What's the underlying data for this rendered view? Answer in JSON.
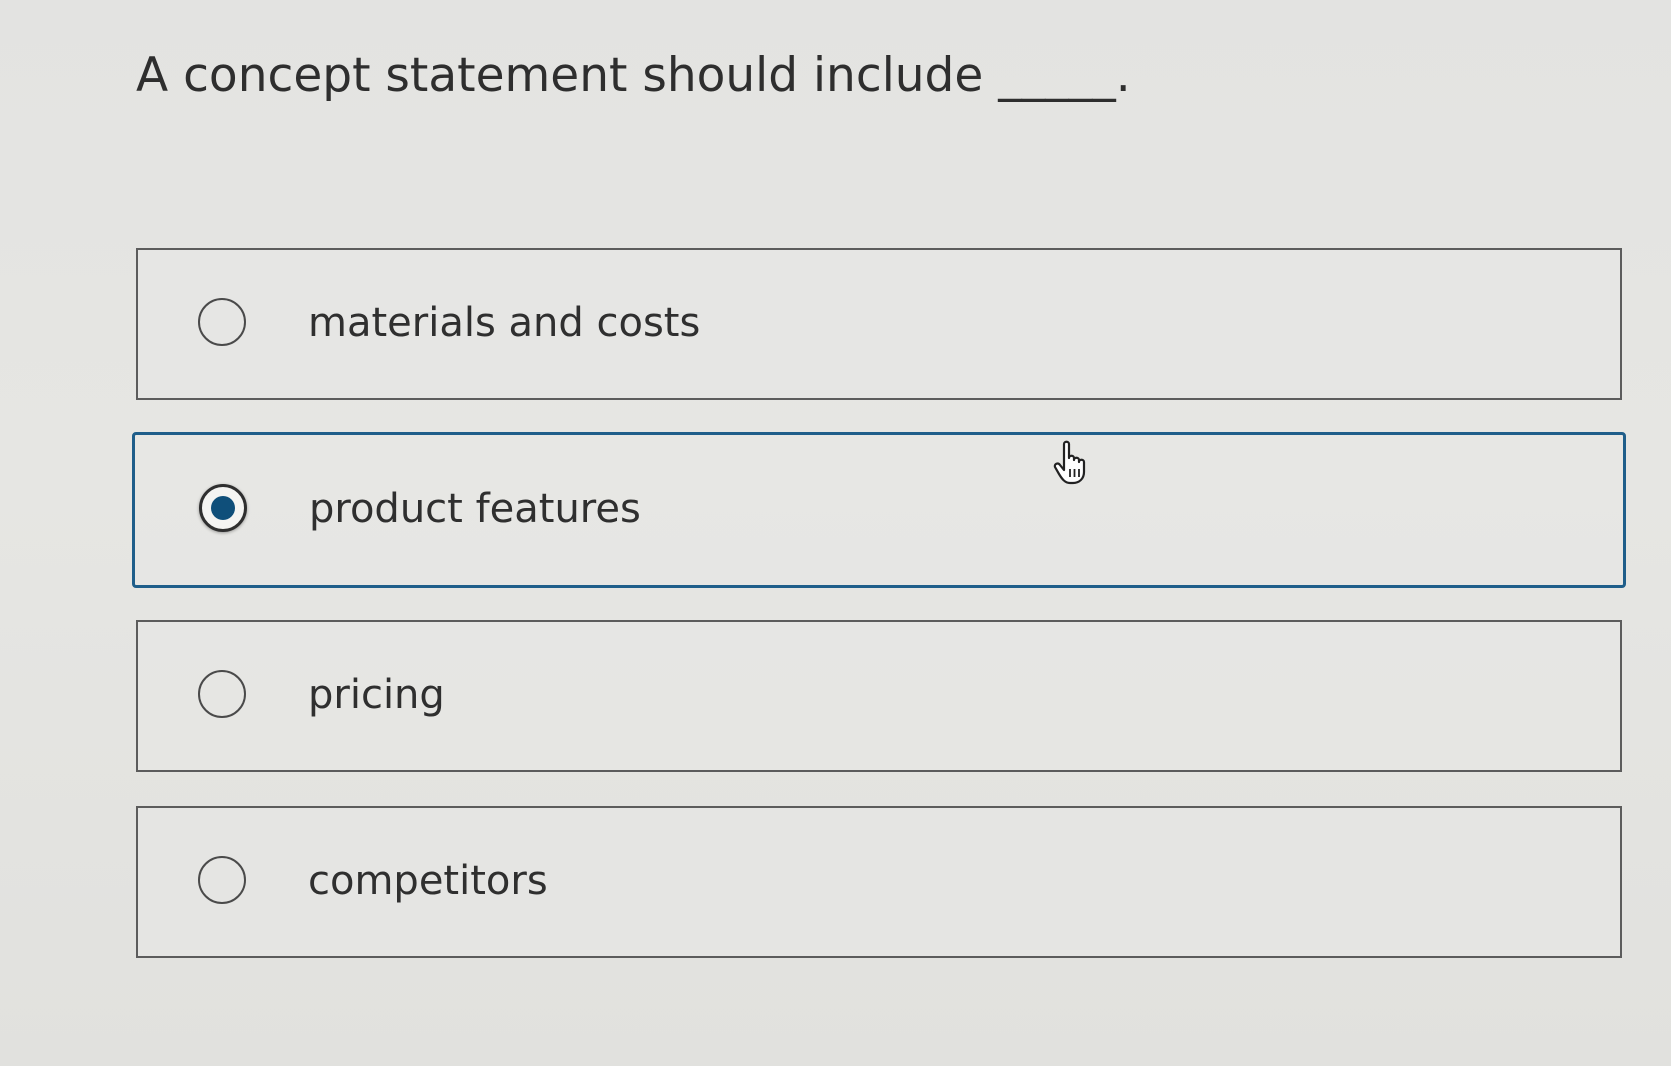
{
  "question": {
    "text": "A concept statement should include _____."
  },
  "options": [
    {
      "label": "materials and costs",
      "selected": false
    },
    {
      "label": "product features",
      "selected": true
    },
    {
      "label": "pricing",
      "selected": false
    },
    {
      "label": "competitors",
      "selected": false
    }
  ],
  "icons": {
    "radio": "radio-button-icon",
    "cursor": "hand-pointer-icon"
  },
  "colors": {
    "accent": "#1f5e8a",
    "selected_dot": "#0f4f7a",
    "text": "#2f2f2f",
    "border": "#5c5c5c",
    "background": "#e4e4e1"
  }
}
